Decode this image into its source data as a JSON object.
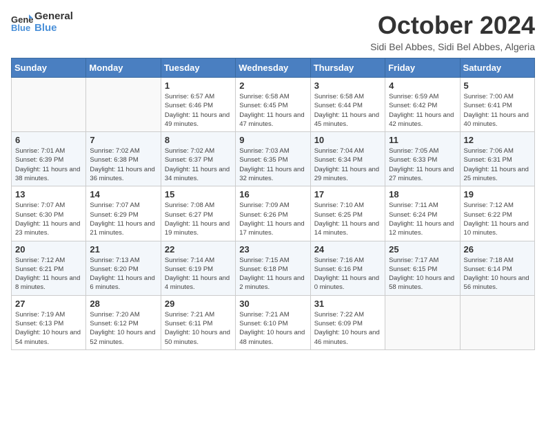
{
  "header": {
    "logo_line1": "General",
    "logo_line2": "Blue",
    "month_title": "October 2024",
    "location": "Sidi Bel Abbes, Sidi Bel Abbes, Algeria"
  },
  "days_of_week": [
    "Sunday",
    "Monday",
    "Tuesday",
    "Wednesday",
    "Thursday",
    "Friday",
    "Saturday"
  ],
  "weeks": [
    [
      {
        "day": "",
        "info": ""
      },
      {
        "day": "",
        "info": ""
      },
      {
        "day": "1",
        "info": "Sunrise: 6:57 AM\nSunset: 6:46 PM\nDaylight: 11 hours and 49 minutes."
      },
      {
        "day": "2",
        "info": "Sunrise: 6:58 AM\nSunset: 6:45 PM\nDaylight: 11 hours and 47 minutes."
      },
      {
        "day": "3",
        "info": "Sunrise: 6:58 AM\nSunset: 6:44 PM\nDaylight: 11 hours and 45 minutes."
      },
      {
        "day": "4",
        "info": "Sunrise: 6:59 AM\nSunset: 6:42 PM\nDaylight: 11 hours and 42 minutes."
      },
      {
        "day": "5",
        "info": "Sunrise: 7:00 AM\nSunset: 6:41 PM\nDaylight: 11 hours and 40 minutes."
      }
    ],
    [
      {
        "day": "6",
        "info": "Sunrise: 7:01 AM\nSunset: 6:39 PM\nDaylight: 11 hours and 38 minutes."
      },
      {
        "day": "7",
        "info": "Sunrise: 7:02 AM\nSunset: 6:38 PM\nDaylight: 11 hours and 36 minutes."
      },
      {
        "day": "8",
        "info": "Sunrise: 7:02 AM\nSunset: 6:37 PM\nDaylight: 11 hours and 34 minutes."
      },
      {
        "day": "9",
        "info": "Sunrise: 7:03 AM\nSunset: 6:35 PM\nDaylight: 11 hours and 32 minutes."
      },
      {
        "day": "10",
        "info": "Sunrise: 7:04 AM\nSunset: 6:34 PM\nDaylight: 11 hours and 29 minutes."
      },
      {
        "day": "11",
        "info": "Sunrise: 7:05 AM\nSunset: 6:33 PM\nDaylight: 11 hours and 27 minutes."
      },
      {
        "day": "12",
        "info": "Sunrise: 7:06 AM\nSunset: 6:31 PM\nDaylight: 11 hours and 25 minutes."
      }
    ],
    [
      {
        "day": "13",
        "info": "Sunrise: 7:07 AM\nSunset: 6:30 PM\nDaylight: 11 hours and 23 minutes."
      },
      {
        "day": "14",
        "info": "Sunrise: 7:07 AM\nSunset: 6:29 PM\nDaylight: 11 hours and 21 minutes."
      },
      {
        "day": "15",
        "info": "Sunrise: 7:08 AM\nSunset: 6:27 PM\nDaylight: 11 hours and 19 minutes."
      },
      {
        "day": "16",
        "info": "Sunrise: 7:09 AM\nSunset: 6:26 PM\nDaylight: 11 hours and 17 minutes."
      },
      {
        "day": "17",
        "info": "Sunrise: 7:10 AM\nSunset: 6:25 PM\nDaylight: 11 hours and 14 minutes."
      },
      {
        "day": "18",
        "info": "Sunrise: 7:11 AM\nSunset: 6:24 PM\nDaylight: 11 hours and 12 minutes."
      },
      {
        "day": "19",
        "info": "Sunrise: 7:12 AM\nSunset: 6:22 PM\nDaylight: 11 hours and 10 minutes."
      }
    ],
    [
      {
        "day": "20",
        "info": "Sunrise: 7:12 AM\nSunset: 6:21 PM\nDaylight: 11 hours and 8 minutes."
      },
      {
        "day": "21",
        "info": "Sunrise: 7:13 AM\nSunset: 6:20 PM\nDaylight: 11 hours and 6 minutes."
      },
      {
        "day": "22",
        "info": "Sunrise: 7:14 AM\nSunset: 6:19 PM\nDaylight: 11 hours and 4 minutes."
      },
      {
        "day": "23",
        "info": "Sunrise: 7:15 AM\nSunset: 6:18 PM\nDaylight: 11 hours and 2 minutes."
      },
      {
        "day": "24",
        "info": "Sunrise: 7:16 AM\nSunset: 6:16 PM\nDaylight: 11 hours and 0 minutes."
      },
      {
        "day": "25",
        "info": "Sunrise: 7:17 AM\nSunset: 6:15 PM\nDaylight: 10 hours and 58 minutes."
      },
      {
        "day": "26",
        "info": "Sunrise: 7:18 AM\nSunset: 6:14 PM\nDaylight: 10 hours and 56 minutes."
      }
    ],
    [
      {
        "day": "27",
        "info": "Sunrise: 7:19 AM\nSunset: 6:13 PM\nDaylight: 10 hours and 54 minutes."
      },
      {
        "day": "28",
        "info": "Sunrise: 7:20 AM\nSunset: 6:12 PM\nDaylight: 10 hours and 52 minutes."
      },
      {
        "day": "29",
        "info": "Sunrise: 7:21 AM\nSunset: 6:11 PM\nDaylight: 10 hours and 50 minutes."
      },
      {
        "day": "30",
        "info": "Sunrise: 7:21 AM\nSunset: 6:10 PM\nDaylight: 10 hours and 48 minutes."
      },
      {
        "day": "31",
        "info": "Sunrise: 7:22 AM\nSunset: 6:09 PM\nDaylight: 10 hours and 46 minutes."
      },
      {
        "day": "",
        "info": ""
      },
      {
        "day": "",
        "info": ""
      }
    ]
  ]
}
